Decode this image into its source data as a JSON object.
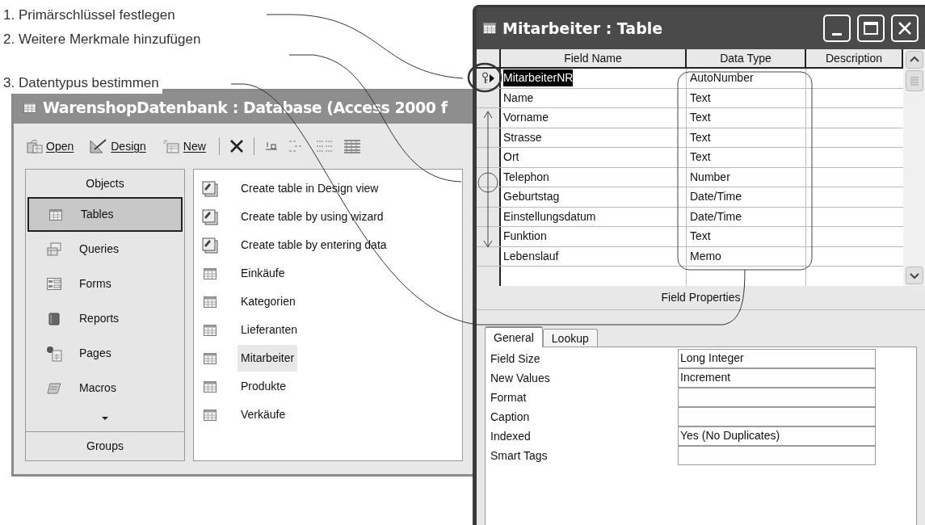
{
  "annotations": [
    "1. Primärschlüssel festlegen",
    "2. Weitere Merkmale hinzufügen",
    "3. Datentypus bestimmen"
  ],
  "database_window": {
    "title": "WarenshopDatenbank : Database (Access 2000 f",
    "toolbar": [
      {
        "label": "Open",
        "kind": "open"
      },
      {
        "label": "Design",
        "kind": "design"
      },
      {
        "label": "New",
        "kind": "new"
      }
    ],
    "objects_header": "Objects",
    "objects": [
      {
        "label": "Tables",
        "kind": "tables",
        "selected": true
      },
      {
        "label": "Queries",
        "kind": "queries",
        "selected": false
      },
      {
        "label": "Forms",
        "kind": "forms",
        "selected": false
      },
      {
        "label": "Reports",
        "kind": "reports",
        "selected": false
      },
      {
        "label": "Pages",
        "kind": "pages",
        "selected": false
      },
      {
        "label": "Macros",
        "kind": "macros",
        "selected": false
      }
    ],
    "groups_label": "Groups",
    "items": [
      {
        "label": "Create table in Design view",
        "kind": "create",
        "selected": false
      },
      {
        "label": "Create table by using wizard",
        "kind": "create",
        "selected": false
      },
      {
        "label": "Create table by entering data",
        "kind": "create",
        "selected": false
      },
      {
        "label": "Einkäufe",
        "kind": "table",
        "selected": false
      },
      {
        "label": "Kategorien",
        "kind": "table",
        "selected": false
      },
      {
        "label": "Lieferanten",
        "kind": "table",
        "selected": false
      },
      {
        "label": "Mitarbeiter",
        "kind": "table",
        "selected": true
      },
      {
        "label": "Produkte",
        "kind": "table",
        "selected": false
      },
      {
        "label": "Verkäufe",
        "kind": "table",
        "selected": false
      }
    ]
  },
  "table_window": {
    "title": "Mitarbeiter : Table",
    "columns": [
      "Field Name",
      "Data Type",
      "Description"
    ],
    "rows": [
      {
        "field_name": "MitarbeiterNR",
        "data_type": "AutoNumber",
        "selected": true,
        "primary_key": true
      },
      {
        "field_name": "Name",
        "data_type": "Text",
        "selected": false,
        "primary_key": false
      },
      {
        "field_name": "Vorname",
        "data_type": "Text",
        "selected": false,
        "primary_key": false
      },
      {
        "field_name": "Strasse",
        "data_type": "Text",
        "selected": false,
        "primary_key": false
      },
      {
        "field_name": "Ort",
        "data_type": "Text",
        "selected": false,
        "primary_key": false
      },
      {
        "field_name": "Telephon",
        "data_type": "Number",
        "selected": false,
        "primary_key": false
      },
      {
        "field_name": "Geburtstag",
        "data_type": "Date/Time",
        "selected": false,
        "primary_key": false
      },
      {
        "field_name": "Einstellungsdatum",
        "data_type": "Date/Time",
        "selected": false,
        "primary_key": false
      },
      {
        "field_name": "Funktion",
        "data_type": "Text",
        "selected": false,
        "primary_key": false
      },
      {
        "field_name": "Lebenslauf",
        "data_type": "Memo",
        "selected": false,
        "primary_key": false
      }
    ],
    "field_properties_label": "Field Properties",
    "tabs": [
      {
        "label": "General",
        "selected": true
      },
      {
        "label": "Lookup",
        "selected": false
      }
    ],
    "properties": [
      {
        "label": "Field Size",
        "value": "Long Integer"
      },
      {
        "label": "New Values",
        "value": "Increment"
      },
      {
        "label": "Format"
      },
      {
        "label": "Caption"
      },
      {
        "label": "Indexed",
        "value": "Yes (No Duplicates)"
      },
      {
        "label": "Smart Tags"
      }
    ]
  }
}
